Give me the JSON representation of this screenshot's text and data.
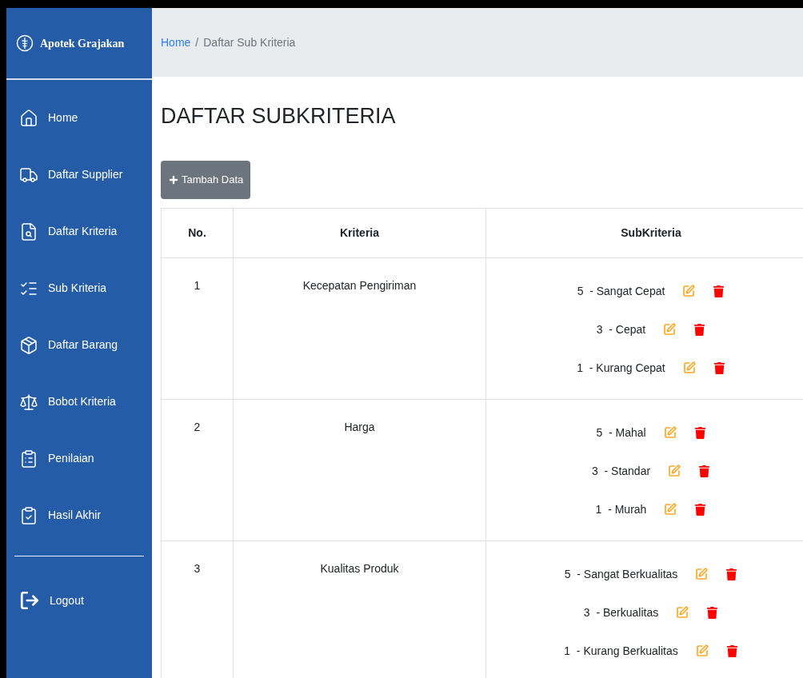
{
  "sidebar": {
    "brand": "Apotek Grajakan",
    "items": [
      {
        "label": "Home",
        "kind": "home"
      },
      {
        "label": "Daftar Supplier",
        "kind": "supplier"
      },
      {
        "label": "Daftar Kriteria",
        "kind": "kriteria"
      },
      {
        "label": "Sub Kriteria",
        "kind": "sub"
      },
      {
        "label": "Daftar Barang",
        "kind": "barang"
      },
      {
        "label": "Bobot Kriteria",
        "kind": "bobot"
      },
      {
        "label": "Penilaian",
        "kind": "penilaian"
      },
      {
        "label": "Hasil Akhir",
        "kind": "hasil"
      }
    ],
    "logout": "Logout"
  },
  "breadcrumb": {
    "link": "Home",
    "separator": "/",
    "current": "Daftar Sub Kriteria"
  },
  "title": "DAFTAR SUBKRITERIA",
  "add_button": "Tambah Data",
  "table": {
    "columns": [
      "No.",
      "Kriteria",
      "SubKriteria"
    ],
    "rows": [
      {
        "no": "1",
        "kriteria": "Kecepatan Pengiriman",
        "subkriteria": [
          "5  - Sangat Cepat",
          "3  - Cepat",
          "1  - Kurang Cepat"
        ]
      },
      {
        "no": "2",
        "kriteria": "Harga",
        "subkriteria": [
          "5  - Mahal",
          "3  - Standar",
          "1  - Murah"
        ]
      },
      {
        "no": "3",
        "kriteria": "Kualitas Produk",
        "subkriteria": [
          "5  - Sangat Berkualitas",
          "3  - Berkualitas",
          "1  - Kurang Berkualitas"
        ]
      }
    ]
  }
}
